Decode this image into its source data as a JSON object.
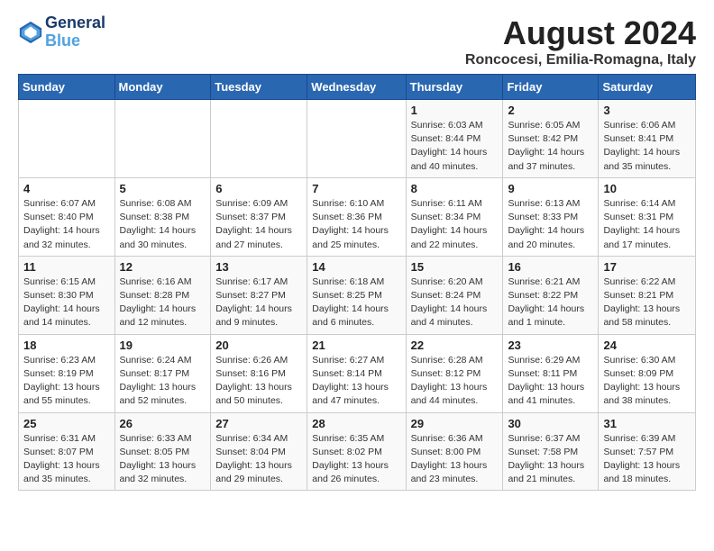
{
  "logo": {
    "line1": "General",
    "line2": "Blue"
  },
  "title": "August 2024",
  "subtitle": "Roncocesi, Emilia-Romagna, Italy",
  "weekdays": [
    "Sunday",
    "Monday",
    "Tuesday",
    "Wednesday",
    "Thursday",
    "Friday",
    "Saturday"
  ],
  "weeks": [
    [
      {
        "day": "",
        "info": ""
      },
      {
        "day": "",
        "info": ""
      },
      {
        "day": "",
        "info": ""
      },
      {
        "day": "",
        "info": ""
      },
      {
        "day": "1",
        "info": "Sunrise: 6:03 AM\nSunset: 8:44 PM\nDaylight: 14 hours\nand 40 minutes."
      },
      {
        "day": "2",
        "info": "Sunrise: 6:05 AM\nSunset: 8:42 PM\nDaylight: 14 hours\nand 37 minutes."
      },
      {
        "day": "3",
        "info": "Sunrise: 6:06 AM\nSunset: 8:41 PM\nDaylight: 14 hours\nand 35 minutes."
      }
    ],
    [
      {
        "day": "4",
        "info": "Sunrise: 6:07 AM\nSunset: 8:40 PM\nDaylight: 14 hours\nand 32 minutes."
      },
      {
        "day": "5",
        "info": "Sunrise: 6:08 AM\nSunset: 8:38 PM\nDaylight: 14 hours\nand 30 minutes."
      },
      {
        "day": "6",
        "info": "Sunrise: 6:09 AM\nSunset: 8:37 PM\nDaylight: 14 hours\nand 27 minutes."
      },
      {
        "day": "7",
        "info": "Sunrise: 6:10 AM\nSunset: 8:36 PM\nDaylight: 14 hours\nand 25 minutes."
      },
      {
        "day": "8",
        "info": "Sunrise: 6:11 AM\nSunset: 8:34 PM\nDaylight: 14 hours\nand 22 minutes."
      },
      {
        "day": "9",
        "info": "Sunrise: 6:13 AM\nSunset: 8:33 PM\nDaylight: 14 hours\nand 20 minutes."
      },
      {
        "day": "10",
        "info": "Sunrise: 6:14 AM\nSunset: 8:31 PM\nDaylight: 14 hours\nand 17 minutes."
      }
    ],
    [
      {
        "day": "11",
        "info": "Sunrise: 6:15 AM\nSunset: 8:30 PM\nDaylight: 14 hours\nand 14 minutes."
      },
      {
        "day": "12",
        "info": "Sunrise: 6:16 AM\nSunset: 8:28 PM\nDaylight: 14 hours\nand 12 minutes."
      },
      {
        "day": "13",
        "info": "Sunrise: 6:17 AM\nSunset: 8:27 PM\nDaylight: 14 hours\nand 9 minutes."
      },
      {
        "day": "14",
        "info": "Sunrise: 6:18 AM\nSunset: 8:25 PM\nDaylight: 14 hours\nand 6 minutes."
      },
      {
        "day": "15",
        "info": "Sunrise: 6:20 AM\nSunset: 8:24 PM\nDaylight: 14 hours\nand 4 minutes."
      },
      {
        "day": "16",
        "info": "Sunrise: 6:21 AM\nSunset: 8:22 PM\nDaylight: 14 hours\nand 1 minute."
      },
      {
        "day": "17",
        "info": "Sunrise: 6:22 AM\nSunset: 8:21 PM\nDaylight: 13 hours\nand 58 minutes."
      }
    ],
    [
      {
        "day": "18",
        "info": "Sunrise: 6:23 AM\nSunset: 8:19 PM\nDaylight: 13 hours\nand 55 minutes."
      },
      {
        "day": "19",
        "info": "Sunrise: 6:24 AM\nSunset: 8:17 PM\nDaylight: 13 hours\nand 52 minutes."
      },
      {
        "day": "20",
        "info": "Sunrise: 6:26 AM\nSunset: 8:16 PM\nDaylight: 13 hours\nand 50 minutes."
      },
      {
        "day": "21",
        "info": "Sunrise: 6:27 AM\nSunset: 8:14 PM\nDaylight: 13 hours\nand 47 minutes."
      },
      {
        "day": "22",
        "info": "Sunrise: 6:28 AM\nSunset: 8:12 PM\nDaylight: 13 hours\nand 44 minutes."
      },
      {
        "day": "23",
        "info": "Sunrise: 6:29 AM\nSunset: 8:11 PM\nDaylight: 13 hours\nand 41 minutes."
      },
      {
        "day": "24",
        "info": "Sunrise: 6:30 AM\nSunset: 8:09 PM\nDaylight: 13 hours\nand 38 minutes."
      }
    ],
    [
      {
        "day": "25",
        "info": "Sunrise: 6:31 AM\nSunset: 8:07 PM\nDaylight: 13 hours\nand 35 minutes."
      },
      {
        "day": "26",
        "info": "Sunrise: 6:33 AM\nSunset: 8:05 PM\nDaylight: 13 hours\nand 32 minutes."
      },
      {
        "day": "27",
        "info": "Sunrise: 6:34 AM\nSunset: 8:04 PM\nDaylight: 13 hours\nand 29 minutes."
      },
      {
        "day": "28",
        "info": "Sunrise: 6:35 AM\nSunset: 8:02 PM\nDaylight: 13 hours\nand 26 minutes."
      },
      {
        "day": "29",
        "info": "Sunrise: 6:36 AM\nSunset: 8:00 PM\nDaylight: 13 hours\nand 23 minutes."
      },
      {
        "day": "30",
        "info": "Sunrise: 6:37 AM\nSunset: 7:58 PM\nDaylight: 13 hours\nand 21 minutes."
      },
      {
        "day": "31",
        "info": "Sunrise: 6:39 AM\nSunset: 7:57 PM\nDaylight: 13 hours\nand 18 minutes."
      }
    ]
  ]
}
